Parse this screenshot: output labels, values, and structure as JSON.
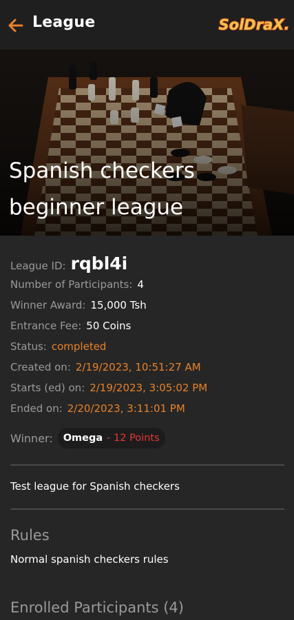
{
  "appbar": {
    "title": "League",
    "logo_text": "SolDraX"
  },
  "hero": {
    "title": "Spanish checkers beginner league"
  },
  "league": {
    "id_label": "League ID:",
    "id_value": "rqbl4i",
    "participants_label": "Number of Participants:",
    "participants_value": "4",
    "award_label": "Winner Award:",
    "award_value": "15,000 Tsh",
    "fee_label": "Entrance Fee:",
    "fee_value": "50 Coins",
    "status_label": "Status:",
    "status_value": "completed",
    "created_label": "Created on:",
    "created_value": "2/19/2023, 10:51:27 AM",
    "starts_label": "Starts (ed) on:",
    "starts_value": "2/19/2023, 3:05:02 PM",
    "ended_label": "Ended on:",
    "ended_value": "2/20/2023, 3:11:01 PM",
    "winner_label": "Winner:",
    "winner_name": "Omega",
    "winner_points": "- 12 Points"
  },
  "description": "Test league for Spanish checkers",
  "rules": {
    "title": "Rules",
    "text": "Normal spanish checkers rules"
  },
  "participants": {
    "title": "Enrolled Participants (4)"
  },
  "colors": {
    "accent": "#e8822a",
    "points": "#e53935",
    "background": "#262626",
    "appbar": "#1f1f1f"
  },
  "icons": {
    "back": "arrow-left-icon"
  }
}
